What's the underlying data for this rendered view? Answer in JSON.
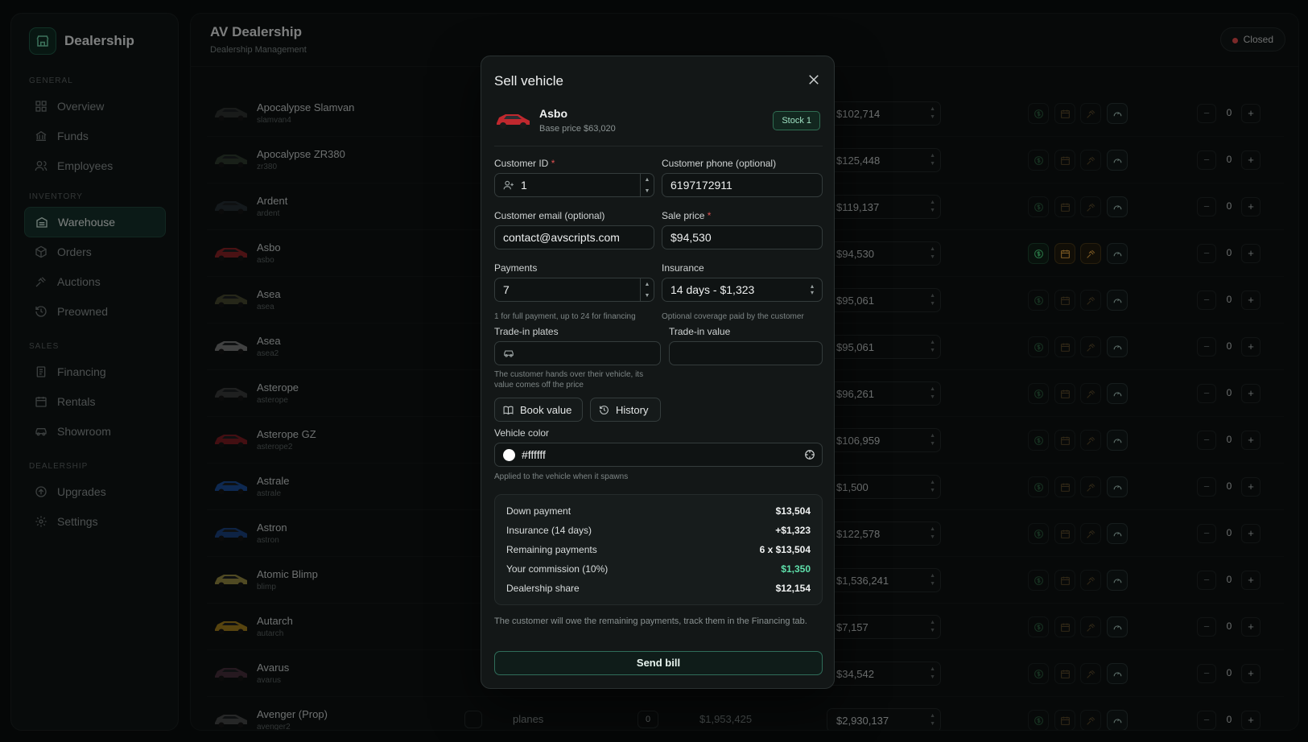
{
  "sidebar": {
    "brand": "Dealership",
    "sections": {
      "general": "General",
      "inventory": "Inventory",
      "sales": "Sales",
      "dealership": "Dealership"
    },
    "items": [
      {
        "label": "Overview",
        "icon": "grid-icon"
      },
      {
        "label": "Funds",
        "icon": "bank-icon"
      },
      {
        "label": "Employees",
        "icon": "users-icon"
      },
      {
        "label": "Warehouse",
        "icon": "warehouse-icon",
        "active": true
      },
      {
        "label": "Orders",
        "icon": "package-icon"
      },
      {
        "label": "Auctions",
        "icon": "gavel-icon"
      },
      {
        "label": "Preowned",
        "icon": "history-icon"
      },
      {
        "label": "Financing",
        "icon": "document-icon"
      },
      {
        "label": "Rentals",
        "icon": "calendar-icon"
      },
      {
        "label": "Showroom",
        "icon": "car-icon"
      },
      {
        "label": "Upgrades",
        "icon": "upgrade-icon"
      },
      {
        "label": "Settings",
        "icon": "gear-icon"
      }
    ]
  },
  "header": {
    "title": "AV Dealership",
    "subtitle": "Dealership Management",
    "status": "Closed"
  },
  "vehicles": [
    {
      "name": "Apocalypse Slamvan",
      "model": "slamvan4",
      "price": "$102,714",
      "qty": "0",
      "color": "#3a3d3b"
    },
    {
      "name": "Apocalypse ZR380",
      "model": "zr380",
      "price": "$125,448",
      "qty": "0",
      "color": "#3b4a3a"
    },
    {
      "name": "Ardent",
      "model": "ardent",
      "price": "$119,137",
      "qty": "0",
      "color": "#2f3a40"
    },
    {
      "name": "Asbo",
      "model": "asbo",
      "price": "$94,530",
      "qty": "0",
      "color": "#b0282c"
    },
    {
      "name": "Asea",
      "model": "asea",
      "price": "$95,061",
      "qty": "0",
      "color": "#5a5a3a"
    },
    {
      "name": "Asea",
      "model": "asea2",
      "price": "$95,061",
      "qty": "0",
      "color": "#9a9a9a"
    },
    {
      "name": "Asterope",
      "model": "asterope",
      "price": "$96,261",
      "qty": "0",
      "color": "#4a4a4a"
    },
    {
      "name": "Asterope GZ",
      "model": "asterope2",
      "price": "$106,959",
      "qty": "0",
      "color": "#a02028"
    },
    {
      "name": "Astrale",
      "model": "astrale",
      "price": "$1,500",
      "qty": "0",
      "color": "#2060c0"
    },
    {
      "name": "Astron",
      "model": "astron",
      "price": "$122,578",
      "qty": "0",
      "color": "#2050a0"
    },
    {
      "name": "Atomic Blimp",
      "model": "blimp",
      "price": "$1,536,241",
      "qty": "0",
      "color": "#c0b050"
    },
    {
      "name": "Autarch",
      "model": "autarch",
      "price": "$7,157",
      "qty": "0",
      "color": "#d0a020"
    },
    {
      "name": "Avarus",
      "model": "avarus",
      "price": "$34,542",
      "qty": "0",
      "color": "#5a3a4a"
    },
    {
      "name": "Avenger (Prop)",
      "model": "avenger2",
      "price": "$2,930,137",
      "qty": "0",
      "color": "#5a5a5a",
      "category": "planes",
      "stock": "0",
      "base": "$1,953,425"
    }
  ],
  "modal": {
    "title": "Sell vehicle",
    "vehicle_name": "Asbo",
    "base_price": "Base price $63,020",
    "stock": "Stock 1",
    "customer_id_label": "Customer ID",
    "customer_id": "1",
    "customer_phone_label": "Customer phone (optional)",
    "customer_phone": "6197172911",
    "customer_email_label": "Customer email (optional)",
    "customer_email": "contact@avscripts.com",
    "sale_price_label": "Sale price",
    "sale_price": "$94,530",
    "payments_label": "Payments",
    "payments": "7",
    "payments_hint": "1 for full payment, up to 24 for financing",
    "insurance_label": "Insurance",
    "insurance": "14 days - $1,323",
    "insurance_hint": "Optional coverage paid by the customer",
    "tradein_plates_label": "Trade-in plates",
    "tradein_value_label": "Trade-in value",
    "tradein_hint": "The customer hands over their vehicle, its value comes off the price",
    "book_value": "Book value",
    "history": "History",
    "vehicle_color_label": "Vehicle color",
    "vehicle_color": "#ffffff",
    "color_hint": "Applied to the vehicle when it spawns",
    "summary": {
      "down_payment_label": "Down payment",
      "down_payment": "$13,504",
      "insurance_label": "Insurance (14 days)",
      "insurance": "+$1,323",
      "remaining_label": "Remaining payments",
      "remaining": "6 x $13,504",
      "commission_label": "Your commission (10%)",
      "commission": "$1,350",
      "share_label": "Dealership share",
      "share": "$12,154"
    },
    "note": "The customer will owe the remaining payments, track them in the Financing tab.",
    "send": "Send bill"
  }
}
